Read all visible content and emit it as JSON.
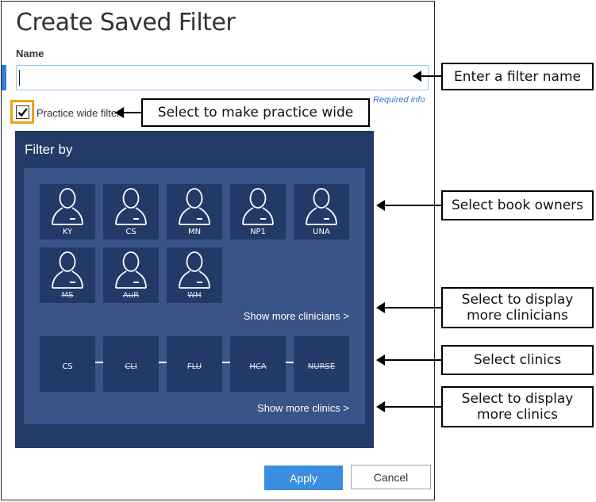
{
  "dialog": {
    "title": "Create Saved Filter",
    "name_label": "Name",
    "name_value": "",
    "required_info": "Required info",
    "practice_wide_label": "Practice wide filter",
    "practice_wide_checked": true
  },
  "filter": {
    "heading": "Filter by",
    "owners": [
      {
        "code": "KY",
        "disabled": false
      },
      {
        "code": "CS",
        "disabled": false
      },
      {
        "code": "MN",
        "disabled": false
      },
      {
        "code": "NP1",
        "disabled": false
      },
      {
        "code": "UNA",
        "disabled": false
      },
      {
        "code": "MS",
        "disabled": true
      },
      {
        "code": "AuR",
        "disabled": true
      },
      {
        "code": "WH",
        "disabled": true
      }
    ],
    "show_more_clinicians": "Show more clinicians >",
    "clinics": [
      {
        "code": "CS",
        "disabled": false
      },
      {
        "code": "CLI",
        "disabled": true
      },
      {
        "code": "FLU",
        "disabled": true
      },
      {
        "code": "HCA",
        "disabled": true
      },
      {
        "code": "NURSE",
        "disabled": true
      }
    ],
    "show_more_clinics": "Show more clinics >"
  },
  "buttons": {
    "apply": "Apply",
    "cancel": "Cancel"
  },
  "callouts": {
    "name": "Enter a filter name",
    "practice": "Select to make practice wide",
    "owners": "Select book owners",
    "more_clinicians": "Select to display more clinicians",
    "clinics": "Select clinics",
    "more_clinics": "Select to display more clinics"
  },
  "colors": {
    "panel": "#243a67",
    "inner": "#3a5487",
    "tile": "#233a68",
    "accent": "#3a8de0",
    "highlight": "#f0a11a"
  }
}
